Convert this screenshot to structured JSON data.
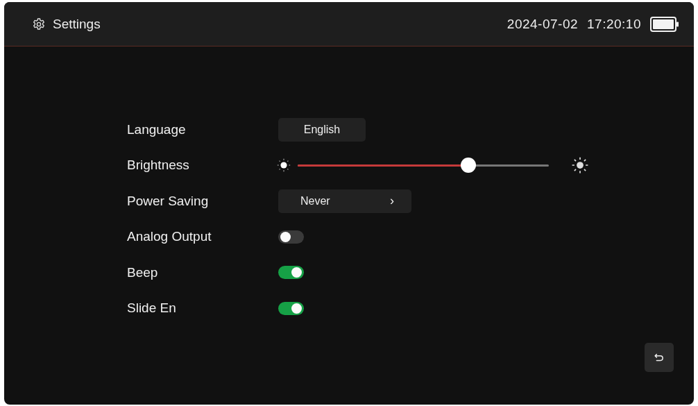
{
  "header": {
    "title": "Settings",
    "date": "2024-07-02",
    "time": "17:20:10"
  },
  "settings": [
    {
      "kind": "select",
      "label": "Language",
      "value": "English"
    },
    {
      "kind": "slider",
      "label": "Brightness",
      "level": 0.68
    },
    {
      "kind": "picker",
      "label": "Power Saving",
      "value": "Never",
      "arrow": "›"
    },
    {
      "kind": "toggle",
      "label": "Analog Output",
      "on": false
    },
    {
      "kind": "toggle",
      "label": "Beep",
      "on": true
    },
    {
      "kind": "toggle",
      "label": "Slide En",
      "on": true
    }
  ]
}
